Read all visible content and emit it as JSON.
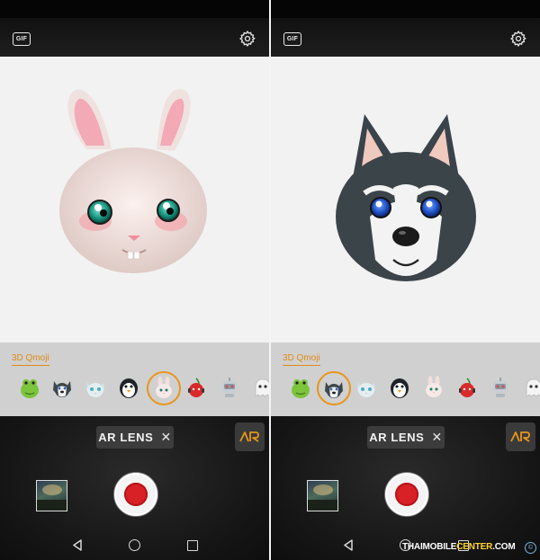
{
  "panels": [
    {
      "id": "left",
      "gif_label": "GIF",
      "avatar": "bunny",
      "strip_label": "3D Qmoji",
      "qmoji": [
        "frog",
        "husky",
        "cat",
        "penguin",
        "bunny",
        "cherry",
        "robot",
        "ghost"
      ],
      "selected_qmoji": "bunny",
      "ar_lens_label": "AR LENS",
      "ar_lens_close": "✕",
      "ar_button_icon": "ar-logo-icon"
    },
    {
      "id": "right",
      "gif_label": "GIF",
      "avatar": "husky",
      "strip_label": "3D Qmoji",
      "qmoji": [
        "frog",
        "husky",
        "cat",
        "penguin",
        "bunny",
        "cherry",
        "robot",
        "ghost"
      ],
      "selected_qmoji": "husky",
      "ar_lens_label": "AR LENS",
      "ar_lens_close": "✕",
      "ar_button_icon": "ar-logo-icon"
    }
  ],
  "icons": {
    "settings": "gear-icon",
    "gallery": "gallery-thumbnail",
    "record": "record-icon",
    "nav_back": "back-icon",
    "nav_home": "home-icon",
    "nav_recent": "recent-apps-icon"
  },
  "watermark": {
    "part1": "THAIMOBILE",
    "part2": "CENTER",
    "part3": ".COM",
    "symbol": "©"
  },
  "colors": {
    "accent": "#e28a12",
    "record": "#d82127",
    "strip": "#d0d0d0",
    "viewport": "#f2f2f2"
  }
}
